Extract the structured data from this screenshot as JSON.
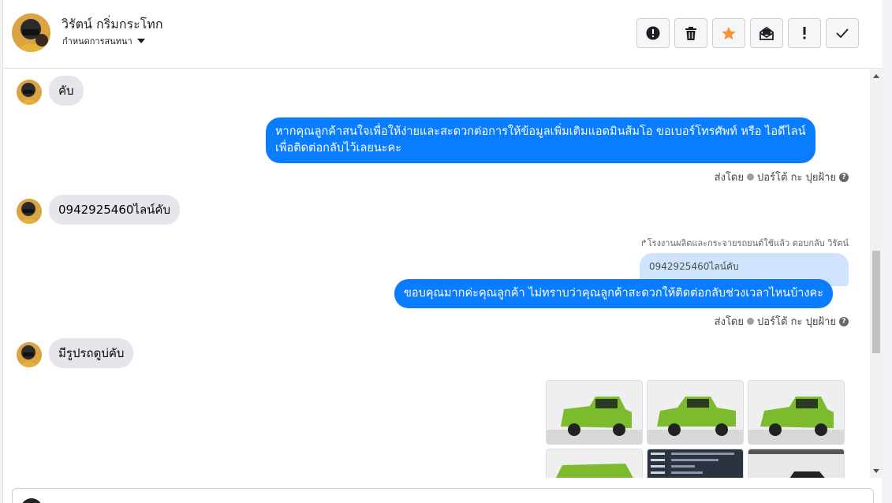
{
  "header": {
    "contact_name": "วิรัตน์ กริ่มกระโทก",
    "subtitle": "กำหนดการสนทนา",
    "toolbar": [
      {
        "name": "alert-circle-icon"
      },
      {
        "name": "trash-icon"
      },
      {
        "name": "star-icon"
      },
      {
        "name": "mark-unread-icon"
      },
      {
        "name": "exclamation-icon"
      },
      {
        "name": "checkmark-icon"
      }
    ]
  },
  "messages": {
    "m1": "คับ",
    "m2_line1": "หากคุณลูกค้าสนใจเพื่อให้ง่ายและสะดวกต่อการให้ข้อมูลเพิ่มเติมแอดมินส้มโอ ขอเบอร์โทรศัพท์ หรือ ไอดีไลน์",
    "m2_line2": "เพื่อติดต่อกลับไว้เลยนะคะ",
    "sent_by_1": "ส่งโดย",
    "agent_1": "ปอร์โต้ กะ ปุยฝ้าย",
    "m3": "0942925460ไลน์คับ",
    "reply_note": "โรงงานผลิตและกระจายรถยนต์ใช้แล้ว ตอบกลับ วิรัตน์",
    "quoted": "0942925460ไลน์คับ",
    "m4": "ขอบคุณมากค่ะคุณลูกค้า ไม่ทราบว่าคุณลูกค้าสะดวกให้ติดต่อกลับช่วงเวลาไหนบ้างคะ",
    "sent_by_2": "ส่งโดย",
    "agent_2": "ปอร์โต้ กะ ปุยฝ้าย",
    "m5": "มีรูปรถดูบ่คับ"
  },
  "colors": {
    "outgoing": "#0a7cff",
    "incoming": "#e4e6eb",
    "star": "#f7923b",
    "truck": "#7dbb2e"
  }
}
